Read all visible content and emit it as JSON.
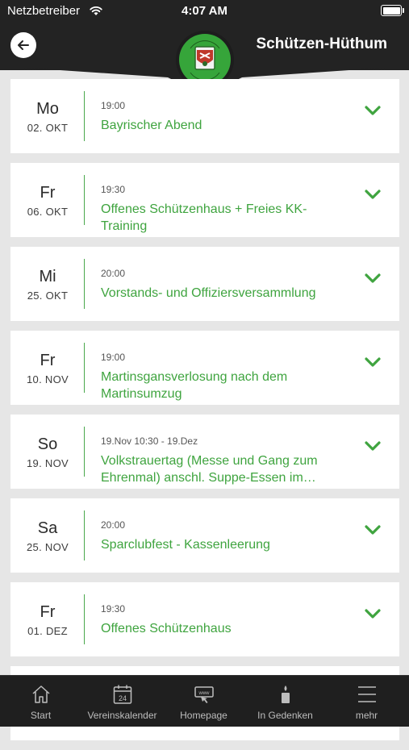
{
  "status_bar": {
    "carrier": "Netzbetreiber",
    "time": "4:07 AM"
  },
  "header": {
    "title": "Schützen-Hüthum"
  },
  "colors": {
    "accent_green": "#3fa43f",
    "dark": "#232323",
    "background": "#e6e6e6"
  },
  "events": [
    {
      "day": "Mo",
      "date": "02. OKT",
      "time": "19:00",
      "title": "Bayrischer Abend"
    },
    {
      "day": "Fr",
      "date": "06. OKT",
      "time": "19:30",
      "title": "Offenes Schützenhaus + Freies KK-Training"
    },
    {
      "day": "Mi",
      "date": "25. OKT",
      "time": "20:00",
      "title": "Vorstands- und Offiziersversammlung"
    },
    {
      "day": "Fr",
      "date": "10. NOV",
      "time": "19:00",
      "title": "Martinsgansverlosung nach dem Martinsumzug"
    },
    {
      "day": "So",
      "date": "19. NOV",
      "time": "19.Nov 10:30 - 19.Dez",
      "title": "Volkstrauertag (Messe und Gang zum Ehrenmal) anschl. Suppe-Essen im…"
    },
    {
      "day": "Sa",
      "date": "25. NOV",
      "time": "20:00",
      "title": "Sparclubfest - Kassenleerung"
    },
    {
      "day": "Fr",
      "date": "01. DEZ",
      "time": "19:30",
      "title": "Offenes Schützenhaus"
    }
  ],
  "tabs": [
    {
      "label": "Start",
      "icon": "home-icon"
    },
    {
      "label": "Vereinskalender",
      "icon": "calendar-icon",
      "calendar_day": "24"
    },
    {
      "label": "Homepage",
      "icon": "www-icon",
      "badge": "www"
    },
    {
      "label": "In Gedenken",
      "icon": "candle-icon"
    },
    {
      "label": "mehr",
      "icon": "menu-icon"
    }
  ]
}
